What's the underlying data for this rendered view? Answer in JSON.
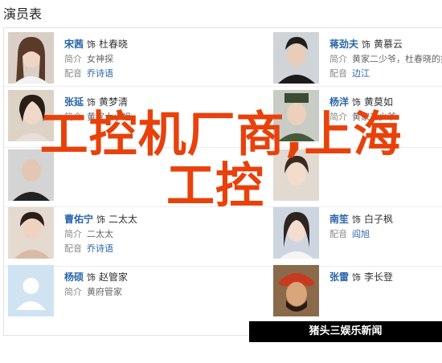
{
  "page_title": "演员表",
  "labels": {
    "dubbing": "配音",
    "intro": "简介"
  },
  "role_sep": "饰",
  "cast": [
    {
      "actor": "宋茜",
      "role": "杜春晓",
      "intro": "女神探",
      "voice": "乔诗语"
    },
    {
      "actor": "蒋劲夫",
      "role": "黄慕云",
      "intro": "黄家二少爷，杜春晓的搭档",
      "voice": "边江"
    },
    {
      "actor": "张延",
      "role": "黄梦清",
      "intro": "黄家大小姐",
      "voice": ""
    },
    {
      "actor": "杨洋",
      "role": "黄莫如",
      "intro": "黄家三少爷",
      "voice": ""
    },
    {
      "actor": "",
      "role": "",
      "intro": "",
      "voice": ""
    },
    {
      "actor": "",
      "role": "",
      "intro": "",
      "voice": ""
    },
    {
      "actor": "曹佑宁",
      "role": "二太太",
      "intro": "二太太",
      "voice": "乔诗语"
    },
    {
      "actor": "南笙",
      "role": "白子枫",
      "intro": "",
      "voice": "阎旭"
    },
    {
      "actor": "杨硕",
      "role": "赵管家",
      "intro": "黄府管家",
      "voice": ""
    },
    {
      "actor": "张雷",
      "role": "李长登",
      "intro": "",
      "voice": ""
    }
  ],
  "watermark": {
    "line1": "工控机厂商,上海",
    "line2": "工控"
  },
  "site_badge": "猪头三娱乐新闻 www.zhutousan.net"
}
